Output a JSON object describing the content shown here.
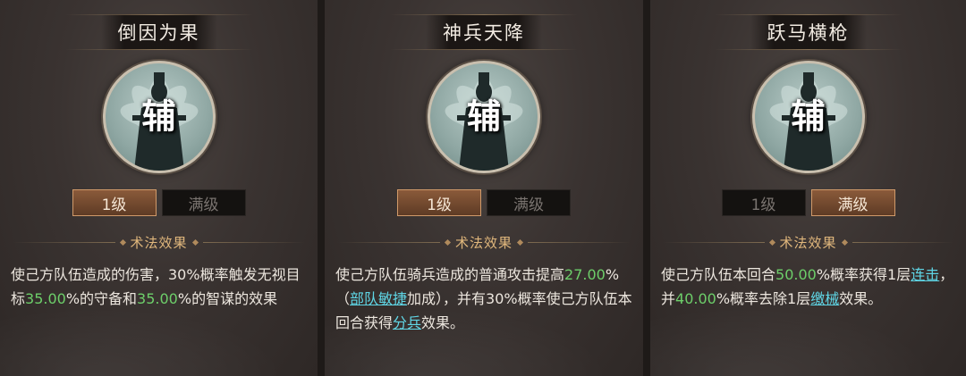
{
  "section_label": "术法效果",
  "role_char": "辅",
  "cards": [
    {
      "title": "倒因为果",
      "level_1": "1级",
      "level_max": "满级",
      "active_level": "1",
      "desc": {
        "p1": "使己方队伍造成的伤害，30%概率触发无视目标",
        "v1": "35.00",
        "p2": "%的守备和",
        "v2": "35.00",
        "p3": "%的智谋的效果"
      }
    },
    {
      "title": "神兵天降",
      "level_1": "1级",
      "level_max": "满级",
      "active_level": "1",
      "desc": {
        "p1": "使己方队伍骑兵造成的普通攻击提高",
        "v1": "27.0",
        "p2": "0",
        "p3": "%（",
        "link1": "部队敏捷",
        "p4": "加成），并有30%概率使己方队伍本回合获得",
        "link2": "分兵",
        "p5": "效果。"
      }
    },
    {
      "title": "跃马横枪",
      "level_1": "1级",
      "level_max": "满级",
      "active_level": "max",
      "desc": {
        "p1": "使己方队伍本回合",
        "v1": "50.00",
        "p2": "%概率获得1层",
        "link1": "连击",
        "p3": "，并",
        "v2": "40.00",
        "p4": "%概率去除1层",
        "link2": "缴械",
        "p5": "效果。"
      }
    }
  ],
  "colors": {
    "green_value": "#6dcf6a",
    "link": "#5fd6e6",
    "section_label": "#e0b77c",
    "active_tab": "#8a5a3a"
  },
  "icons": {
    "portrait": "strategist-silhouette-icon"
  }
}
